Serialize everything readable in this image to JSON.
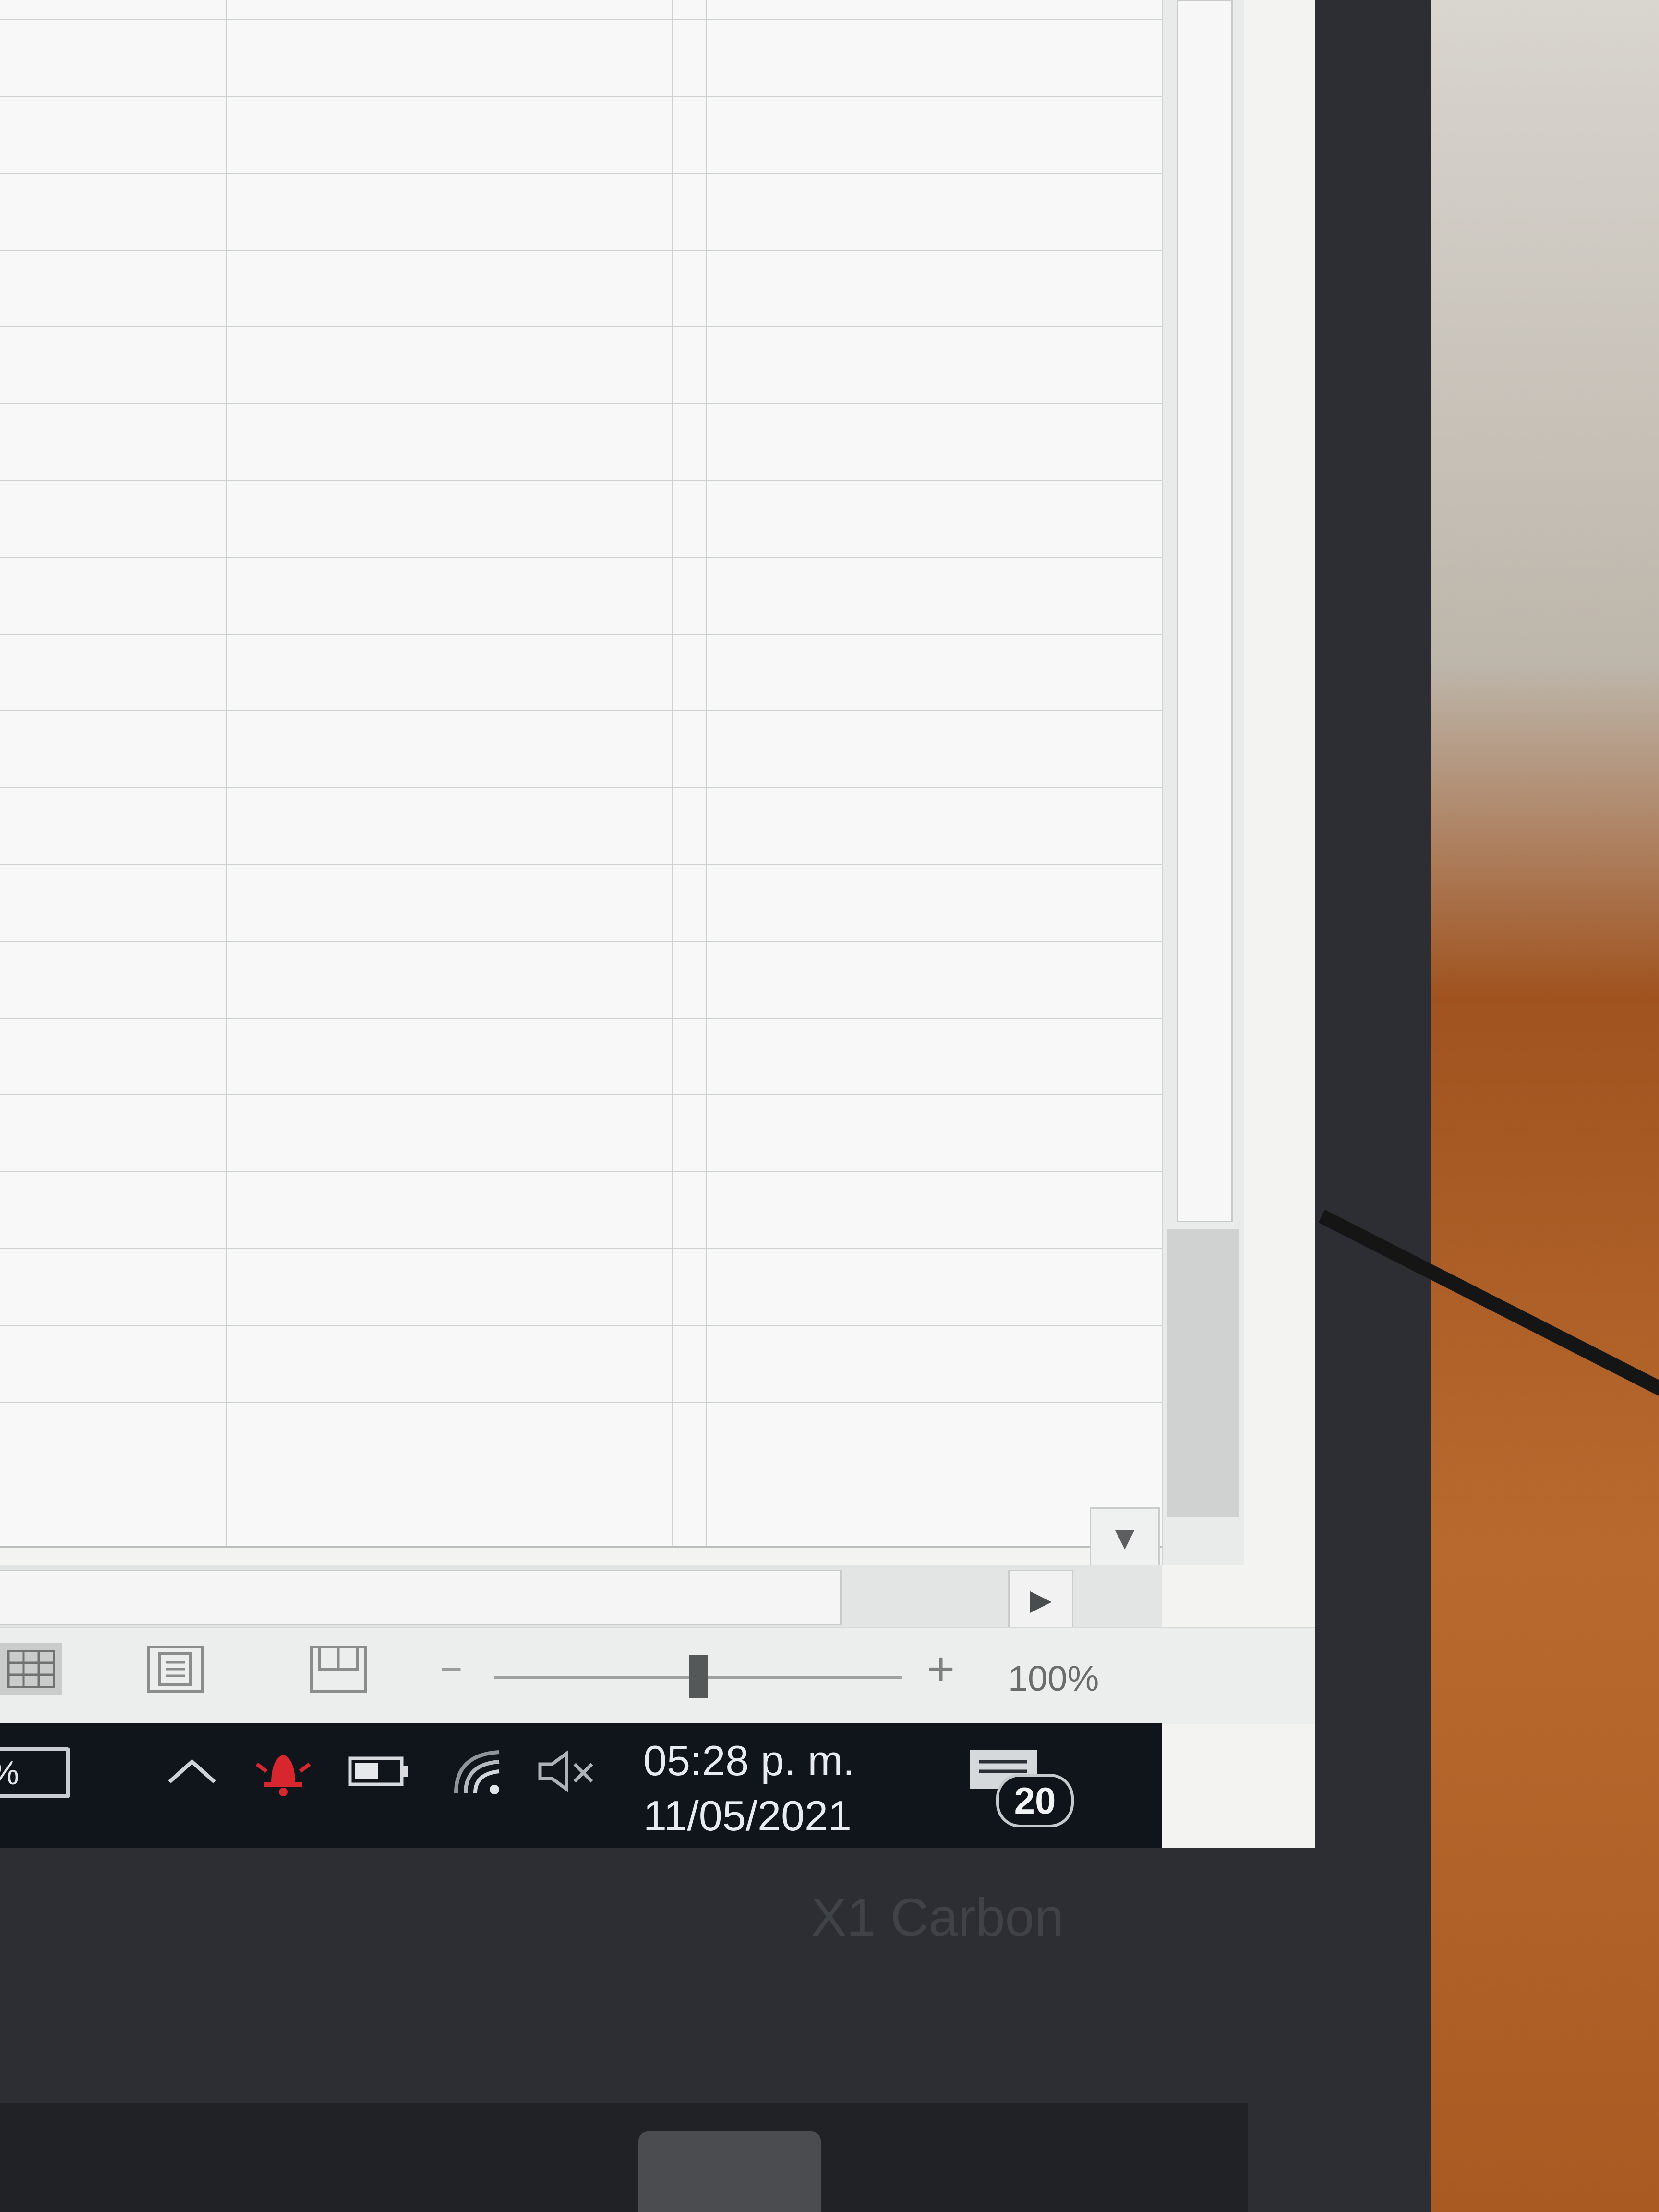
{
  "statusbar": {
    "view_normal_icon": "grid-icon",
    "view_page_layout_icon": "page-layout-icon",
    "view_page_break_icon": "page-break-preview-icon",
    "zoom_out_label": "−",
    "zoom_in_label": "+",
    "zoom_level": "100%",
    "zoom_fraction": 0.5
  },
  "scrollbar": {
    "down_arrow": "▼",
    "right_arrow": "▶"
  },
  "taskbar": {
    "battery_partial_text": "%",
    "clock_time": "05:28 p. m.",
    "clock_date": "11/05/2021",
    "notification_count": "20",
    "icons": [
      "chevron-up-icon",
      "notification-bell-icon",
      "battery-icon",
      "wifi-icon",
      "volume-muted-icon",
      "action-center-icon"
    ]
  },
  "device": {
    "brand_text": "X1 Carbon"
  },
  "colors": {
    "taskbar_bg": "#10151c",
    "bezel": "#2c2e33",
    "grid_line": "#cdd1d0",
    "notif_red": "#d8262f"
  }
}
